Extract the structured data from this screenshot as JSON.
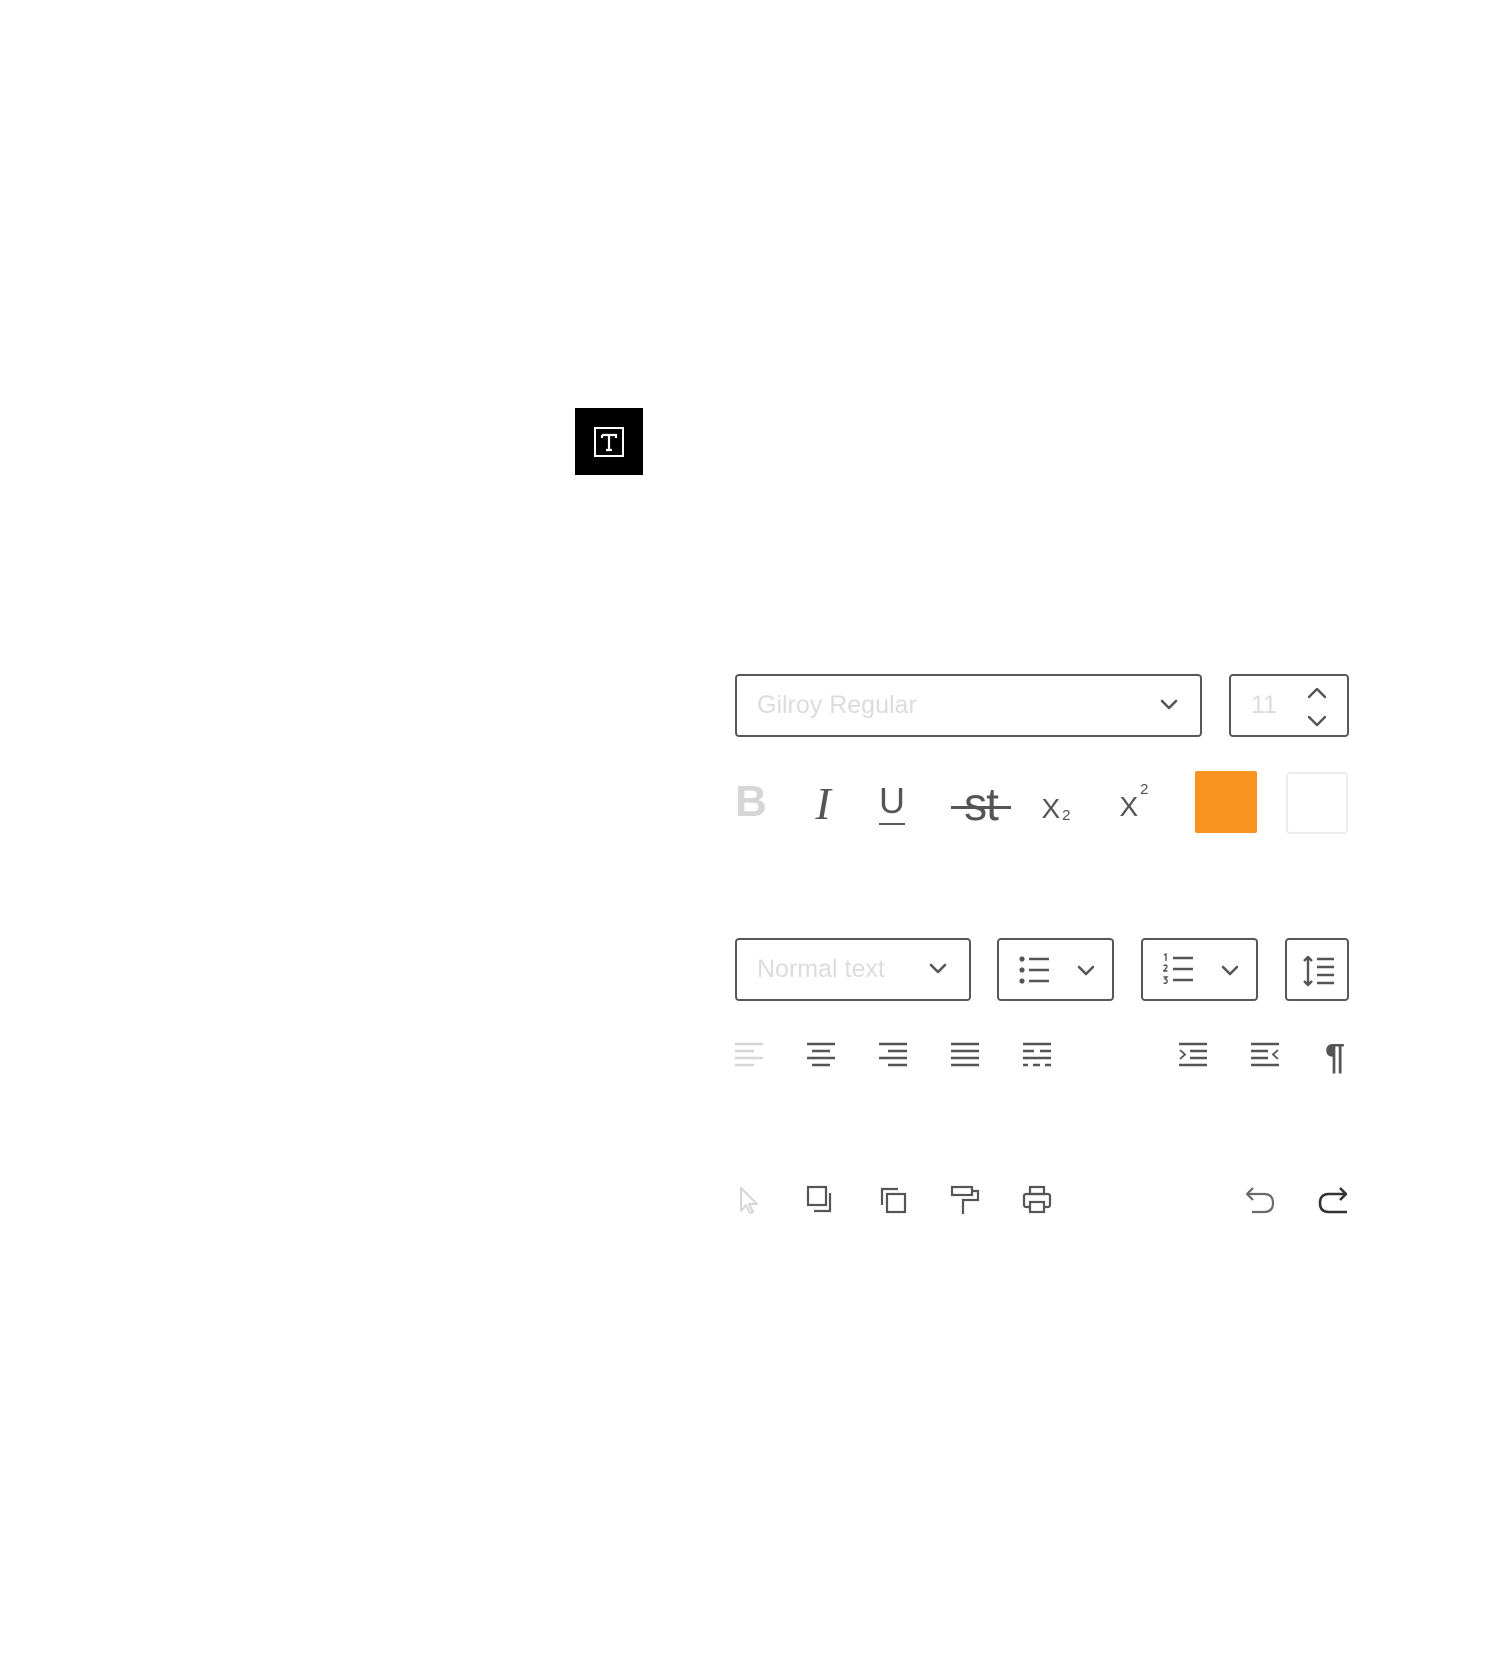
{
  "text_tool": {
    "icon": "text-tool-icon"
  },
  "font": {
    "family_value": "Gilroy Regular",
    "size_value": "11"
  },
  "formatting": {
    "bold_label": "B",
    "italic_label": "I",
    "underline_label": "U",
    "strikethrough_label": "st",
    "subscript_base": "X",
    "subscript_mark": "2",
    "superscript_base": "X",
    "superscript_mark": "2",
    "text_color": "#f7931e",
    "highlight_color": "#ffffff"
  },
  "paragraph": {
    "style_value": "Normal text",
    "pilcrow": "¶"
  },
  "colors": {
    "border": "#585858",
    "placeholder": "#dcdcdc",
    "icon_active": "#555555",
    "icon_disabled": "#d6d6d6",
    "accent": "#f7931e"
  }
}
